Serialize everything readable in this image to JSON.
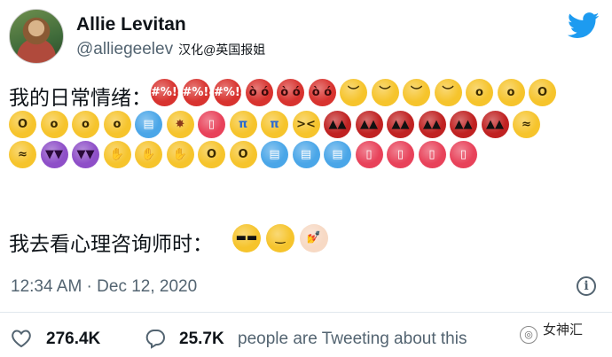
{
  "header": {
    "name": "Allie Levitan",
    "handle": "@alliegeelev",
    "credit": "汉化@英国报姐"
  },
  "tweet": {
    "line1_label": "我的日常情绪：",
    "line2_label": "我去看心理咨询师时：",
    "mood_emojis": [
      {
        "icon": "cursing-face",
        "color": "#d8332f",
        "glyph": "#%!&",
        "fg": "#ffffff"
      },
      {
        "icon": "cursing-face",
        "color": "#d8332f",
        "glyph": "#%!&",
        "fg": "#ffffff"
      },
      {
        "icon": "cursing-face",
        "color": "#d8332f",
        "glyph": "#%!&",
        "fg": "#ffffff"
      },
      {
        "icon": "pouting-face",
        "color": "#d8332f",
        "glyph": "ò ó",
        "fg": "#3a0a0a"
      },
      {
        "icon": "pouting-face",
        "color": "#d8332f",
        "glyph": "ò ó",
        "fg": "#3a0a0a"
      },
      {
        "icon": "pouting-face",
        "color": "#d8332f",
        "glyph": "ò ó",
        "fg": "#3a0a0a"
      },
      {
        "icon": "downcast-sweat-face",
        "color": "#f6c42c",
        "glyph": "︶",
        "fg": "#3a2a00"
      },
      {
        "icon": "downcast-sweat-face",
        "color": "#f6c42c",
        "glyph": "︶",
        "fg": "#3a2a00"
      },
      {
        "icon": "downcast-sweat-face",
        "color": "#f6c42c",
        "glyph": "︶",
        "fg": "#3a2a00"
      },
      {
        "icon": "downcast-sweat-face",
        "color": "#f6c42c",
        "glyph": "︶",
        "fg": "#3a2a00"
      },
      {
        "icon": "anxious-sweat-face",
        "color": "#f6c42c",
        "glyph": "o",
        "fg": "#3a2a00"
      },
      {
        "icon": "anxious-sweat-face",
        "color": "#f6c42c",
        "glyph": "o",
        "fg": "#3a2a00"
      },
      {
        "icon": "screaming-face",
        "color": "#f6c42c",
        "glyph": "O",
        "fg": "#3a2a00"
      },
      {
        "icon": "screaming-face",
        "color": "#f6c42c",
        "glyph": "O",
        "fg": "#3a2a00"
      },
      {
        "icon": "fearful-face",
        "color": "#f6c42c",
        "glyph": "o",
        "fg": "#3a2a00"
      },
      {
        "icon": "fearful-face",
        "color": "#f6c42c",
        "glyph": "o",
        "fg": "#3a2a00"
      },
      {
        "icon": "fearful-face",
        "color": "#f6c42c",
        "glyph": "o",
        "fg": "#3a2a00"
      },
      {
        "icon": "cold-face",
        "color": "#4aa6e8",
        "glyph": "▤",
        "fg": "#ffffff"
      },
      {
        "icon": "exploding-head",
        "color": "#f6c42c",
        "glyph": "✸",
        "fg": "#8a3a1a"
      },
      {
        "icon": "hot-face",
        "color": "#e8425a",
        "glyph": "▯",
        "fg": "#ffffff"
      },
      {
        "icon": "crying-face",
        "color": "#f6c42c",
        "glyph": "π",
        "fg": "#2a6ad0"
      },
      {
        "icon": "crying-face",
        "color": "#f6c42c",
        "glyph": "π",
        "fg": "#2a6ad0"
      },
      {
        "icon": "persevering-face",
        "color": "#f6c42c",
        "glyph": "><",
        "fg": "#3a2a00"
      },
      {
        "icon": "ogre-face",
        "color": "#c02222",
        "glyph": "▲▲",
        "fg": "#111111"
      },
      {
        "icon": "ogre-face",
        "color": "#c02222",
        "glyph": "▲▲",
        "fg": "#111111"
      },
      {
        "icon": "ogre-face",
        "color": "#c02222",
        "glyph": "▲▲",
        "fg": "#111111"
      },
      {
        "icon": "ogre-face",
        "color": "#c02222",
        "glyph": "▲▲",
        "fg": "#111111"
      },
      {
        "icon": "ogre-face",
        "color": "#c02222",
        "glyph": "▲▲",
        "fg": "#111111"
      },
      {
        "icon": "ogre-face",
        "color": "#c02222",
        "glyph": "▲▲",
        "fg": "#111111"
      },
      {
        "icon": "woozy-face",
        "color": "#f6c42c",
        "glyph": "≈",
        "fg": "#3a2a00"
      },
      {
        "icon": "woozy-face",
        "color": "#f6c42c",
        "glyph": "≈",
        "fg": "#3a2a00"
      },
      {
        "icon": "angry-devil-face",
        "color": "#8e4fc8",
        "glyph": "▼▼",
        "fg": "#2a0a3a"
      },
      {
        "icon": "angry-devil-face",
        "color": "#8e4fc8",
        "glyph": "▼▼",
        "fg": "#2a0a3a"
      },
      {
        "icon": "yawning-face",
        "color": "#f6c42c",
        "glyph": "✋",
        "fg": "#c87a10"
      },
      {
        "icon": "yawning-face",
        "color": "#f6c42c",
        "glyph": "✋",
        "fg": "#c87a10"
      },
      {
        "icon": "yawning-face",
        "color": "#f6c42c",
        "glyph": "✋",
        "fg": "#c87a10"
      },
      {
        "icon": "screaming-face",
        "color": "#f6c42c",
        "glyph": "O",
        "fg": "#3a2a00"
      },
      {
        "icon": "screaming-face",
        "color": "#f6c42c",
        "glyph": "O",
        "fg": "#3a2a00"
      },
      {
        "icon": "cold-face",
        "color": "#4aa6e8",
        "glyph": "▤",
        "fg": "#ffffff"
      },
      {
        "icon": "cold-face",
        "color": "#4aa6e8",
        "glyph": "▤",
        "fg": "#ffffff"
      },
      {
        "icon": "cold-face",
        "color": "#4aa6e8",
        "glyph": "▤",
        "fg": "#ffffff"
      },
      {
        "icon": "hot-face",
        "color": "#e8425a",
        "glyph": "▯",
        "fg": "#ffffff"
      },
      {
        "icon": "hot-face",
        "color": "#e8425a",
        "glyph": "▯",
        "fg": "#ffffff"
      },
      {
        "icon": "hot-face",
        "color": "#e8425a",
        "glyph": "▯",
        "fg": "#ffffff"
      },
      {
        "icon": "hot-face",
        "color": "#e8425a",
        "glyph": "▯",
        "fg": "#ffffff"
      }
    ],
    "therapy_emojis": [
      {
        "icon": "sunglasses-face",
        "color": "#f6c42c",
        "glyph": "▬▬",
        "fg": "#111111"
      },
      {
        "icon": "slightly-smiling-face",
        "color": "#f6c42c",
        "glyph": "‿",
        "fg": "#3a2a00"
      },
      {
        "icon": "nail-polish",
        "color": "#f7d9c4",
        "glyph": "💅",
        "fg": "#c84aa0"
      }
    ]
  },
  "meta": {
    "timestamp": "12:34 AM · Dec 12, 2020",
    "info_glyph": "i"
  },
  "actions": {
    "likes": "276.4K",
    "replies": "25.7K",
    "reply_text": "people are Tweeting about this"
  },
  "watermark": {
    "logo_glyph": "◎",
    "text": "女神汇"
  },
  "colors": {
    "twitter_blue": "#1d9bf0",
    "secondary_text": "#536471"
  }
}
